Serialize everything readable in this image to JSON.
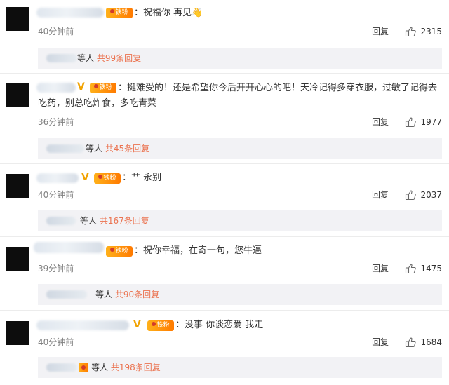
{
  "actions": {
    "reply_label": "回复"
  },
  "comments": [
    {
      "content": "：祝福你 再见👋",
      "time": "40分钟前",
      "likes": "2315",
      "sub_summary": "等人 共99条回复"
    },
    {
      "content": "：挺难受的！还是希望你今后开开心心的吧！天冷记得多穿衣服，过敏了记得去吃药，别总吃炸食，多吃青菜",
      "time": "36分钟前",
      "likes": "1977",
      "sub_summary": "等人 共45条回复"
    },
    {
      "content": "：艹 永别",
      "time": "40分钟前",
      "likes": "2037",
      "sub_summary": "等人 共167条回复"
    },
    {
      "content": "：祝你幸福，在寄一句，您牛逼",
      "time": "39分钟前",
      "likes": "1475",
      "sub_summary": "等人 共90条回复"
    },
    {
      "content": "：没事 你谈恋爱 我走",
      "time": "40分钟前",
      "likes": "1684",
      "sub_summary": "等人 共198条回复"
    }
  ],
  "badges": {
    "fan_label": "铁粉",
    "verified_mark": "V"
  },
  "colors": {
    "accent": "#eb7350",
    "fan_badge": "#ff9800",
    "verified": "#f1a200"
  }
}
